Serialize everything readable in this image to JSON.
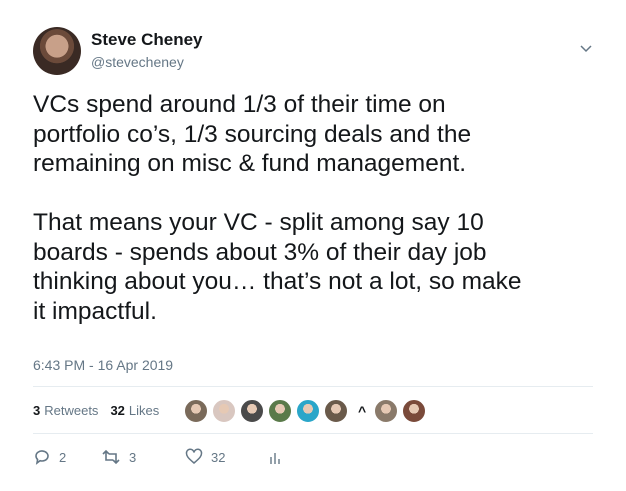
{
  "author": {
    "name": "Steve Cheney",
    "handle": "@stevecheney"
  },
  "tweet": {
    "text": "VCs spend around 1/3 of their time on\nportfolio co’s, 1/3 sourcing deals and the\nremaining on misc & fund management.\n\nThat means your VC - split among say 10\nboards - spends about 3% of their day job\nthinking about you… that’s not a lot, so make\nit impactful.",
    "timestamp": "6:43 PM - 16 Apr 2019"
  },
  "stats": {
    "retweets_count": "3",
    "retweets_label": "Retweets",
    "likes_count": "32",
    "likes_label": "Likes",
    "more_caret": "^"
  },
  "likers": [
    {
      "color": "#7a6a5a"
    },
    {
      "color": "#d9c7c0"
    },
    {
      "color": "#4a4a4a"
    },
    {
      "color": "#5a7a4a"
    },
    {
      "color": "#2aa6c9"
    },
    {
      "color": "#6a5a4a"
    },
    {
      "color": "#8a7a6a"
    },
    {
      "color": "#7a4a3a"
    }
  ],
  "actions": {
    "replies": "2",
    "retweets": "3",
    "likes": "32"
  },
  "colors": {
    "text": "#14171a",
    "muted": "#657786",
    "divider": "#e6ecf0"
  }
}
